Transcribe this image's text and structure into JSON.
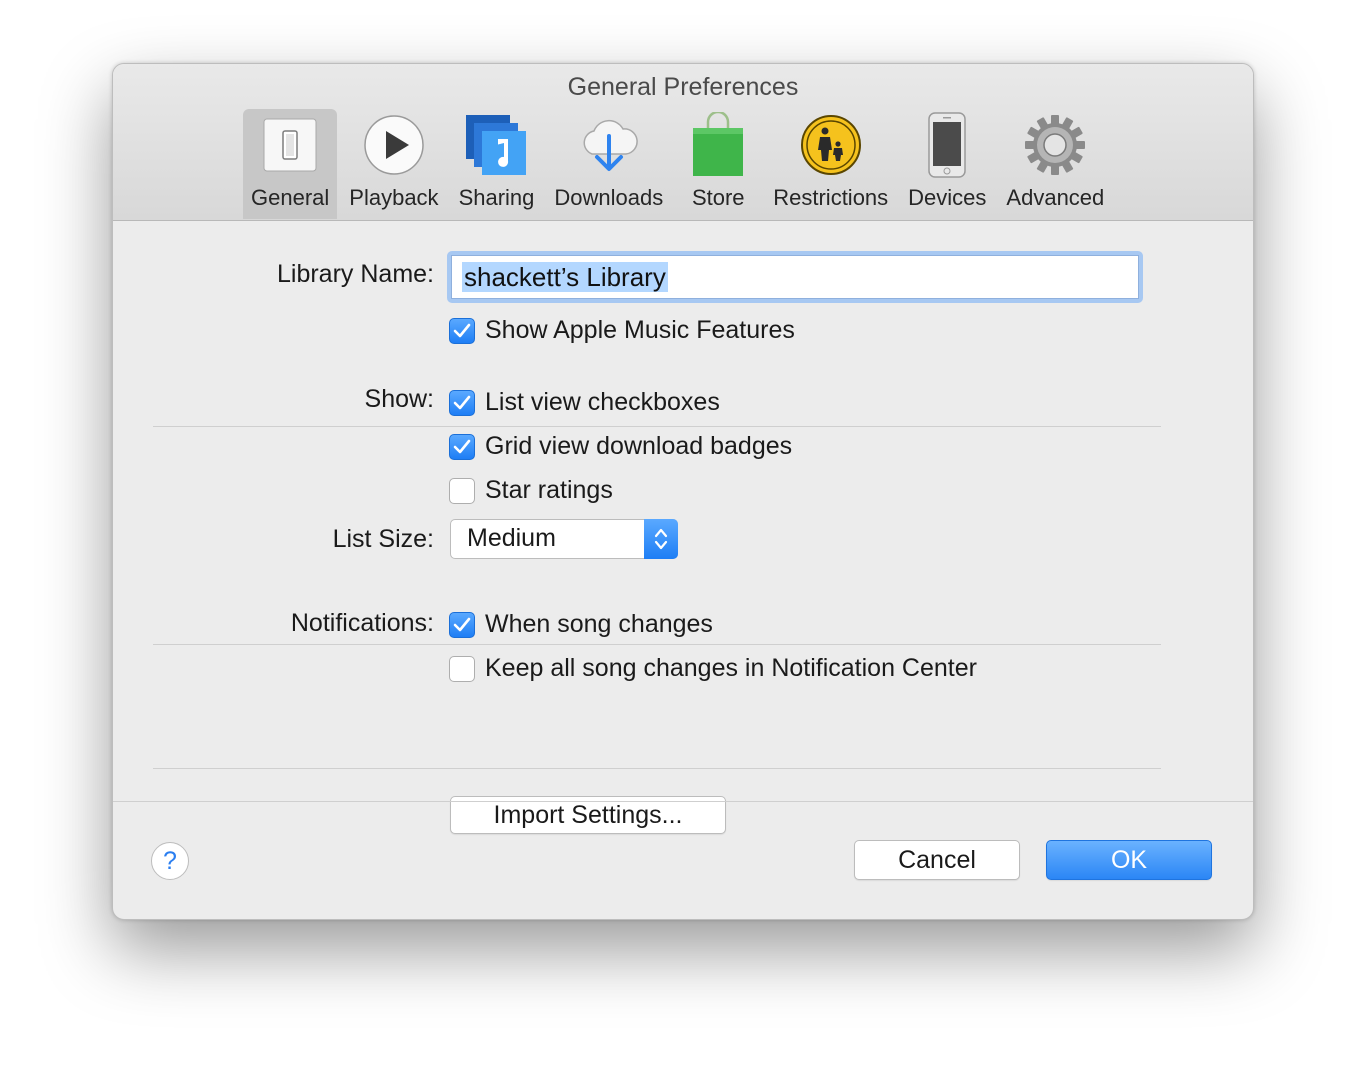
{
  "window": {
    "title": "General Preferences"
  },
  "toolbar": {
    "items": [
      {
        "label": "General",
        "icon": "general-switch-icon",
        "active": true
      },
      {
        "label": "Playback",
        "icon": "play-icon"
      },
      {
        "label": "Sharing",
        "icon": "sharing-music-note-icon"
      },
      {
        "label": "Downloads",
        "icon": "cloud-download-icon"
      },
      {
        "label": "Store",
        "icon": "shopping-bag-icon"
      },
      {
        "label": "Restrictions",
        "icon": "parental-controls-icon"
      },
      {
        "label": "Devices",
        "icon": "iphone-icon"
      },
      {
        "label": "Advanced",
        "icon": "gear-icon"
      }
    ]
  },
  "library": {
    "label": "Library Name:",
    "value": "shackett’s Library",
    "show_apple_music": {
      "label": "Show Apple Music Features",
      "checked": true
    }
  },
  "show": {
    "label": "Show:",
    "list_view_checkboxes": {
      "label": "List view checkboxes",
      "checked": true
    },
    "grid_view_badges": {
      "label": "Grid view download badges",
      "checked": true
    },
    "star_ratings": {
      "label": "Star ratings",
      "checked": false
    }
  },
  "list_size": {
    "label": "List Size:",
    "value": "Medium"
  },
  "notifications": {
    "label": "Notifications:",
    "when_song_changes": {
      "label": "When song changes",
      "checked": true
    },
    "keep_all": {
      "label": "Keep all song changes in Notification Center",
      "checked": false
    }
  },
  "import_button": "Import Settings...",
  "footer": {
    "help": "?",
    "cancel": "Cancel",
    "ok": "OK"
  },
  "colors": {
    "accent": "#2b86f5",
    "focus_ring": "#a7c8f2",
    "selection": "#b3d7ff"
  }
}
